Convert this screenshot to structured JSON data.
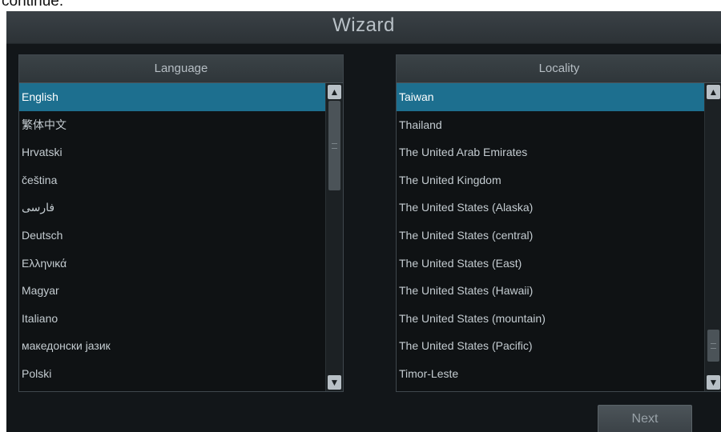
{
  "page_fragment": "continue.",
  "window": {
    "title": "Wizard"
  },
  "language_panel": {
    "header": "Language",
    "items": [
      "English",
      "繁体中文",
      "Hrvatski",
      "čeština",
      "فارسی",
      "Deutsch",
      "Ελληνικά",
      "Magyar",
      "Italiano",
      "македонски јазик",
      "Polski"
    ],
    "selected": "English"
  },
  "locality_panel": {
    "header": "Locality",
    "items": [
      "Taiwan",
      "Thailand",
      "The United Arab Emirates",
      "The United Kingdom",
      "The United States (Alaska)",
      "The United States (central)",
      "The United States (East)",
      "The United States (Hawaii)",
      "The United States (mountain)",
      "The United States (Pacific)",
      "Timor-Leste"
    ],
    "selected": "Taiwan"
  },
  "footer": {
    "next_label": "Next"
  },
  "colors": {
    "selection": "#1d6f8f",
    "background": "#121619"
  },
  "icons": {
    "scroll_up": "chevron-up-icon",
    "scroll_down": "chevron-down-icon"
  }
}
